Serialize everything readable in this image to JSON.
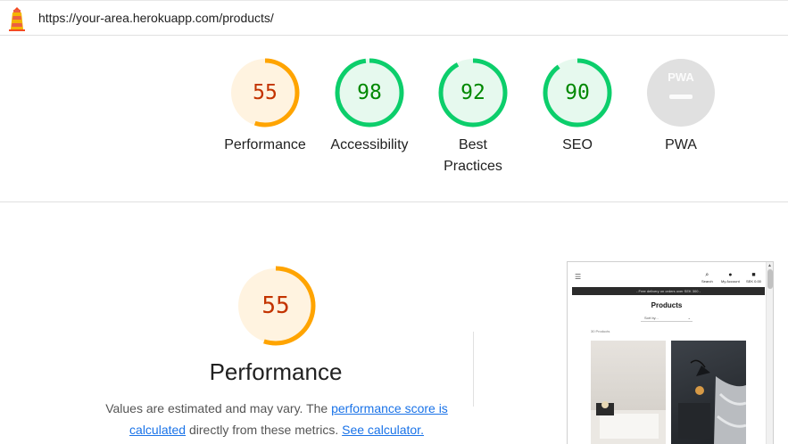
{
  "url_bar": {
    "url": "https://your-area.herokuapp.com/products/"
  },
  "scores": [
    {
      "label": "Performance",
      "value": "55",
      "fraction": 0.55,
      "color": "#ffa400",
      "text_color": "#c33300",
      "bg": "#fff3e0"
    },
    {
      "label": "Accessibility",
      "value": "98",
      "fraction": 0.98,
      "color": "#0cce6b",
      "text_color": "#008800",
      "bg": "#e6f9ee"
    },
    {
      "label": "Best\nPractices",
      "value": "92",
      "fraction": 0.92,
      "color": "#0cce6b",
      "text_color": "#008800",
      "bg": "#e6f9ee"
    },
    {
      "label": "SEO",
      "value": "90",
      "fraction": 0.9,
      "color": "#0cce6b",
      "text_color": "#008800",
      "bg": "#e6f9ee"
    },
    {
      "label": "PWA",
      "value": "PWA",
      "fraction": 0,
      "color": "#cccccc",
      "text_color": "#9e9e9e",
      "bg": "#e0e0e0"
    }
  ],
  "performance_section": {
    "score": "55",
    "fraction": 0.55,
    "title": "Performance",
    "desc_prefix": "Values are estimated and may vary. The ",
    "link_score": "performance score is calculated",
    "desc_middle": " directly from these metrics. ",
    "link_calculator": "See calculator."
  },
  "screenshot_preview": {
    "nav": [
      "Search",
      "My Account",
      "SEK 0.00"
    ],
    "banner": "- Free delivery on orders over SEK 300 -",
    "title": "Products",
    "sort_label": "Sort by...",
    "count": "30 Products"
  }
}
